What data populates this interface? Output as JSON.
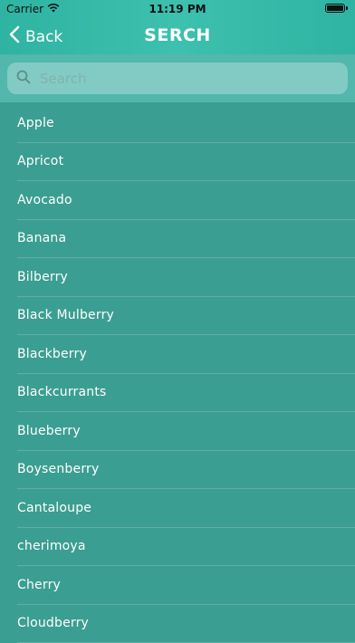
{
  "status_bar": {
    "carrier": "Carrier",
    "time": "11:19 PM"
  },
  "nav": {
    "back_label": "Back",
    "title": "SERCH"
  },
  "search": {
    "placeholder": "Search"
  },
  "fruits": [
    "Apple",
    "Apricot",
    "Avocado",
    "Banana",
    "Bilberry",
    "Black Mulberry",
    "Blackberry",
    "Blackcurrants",
    "Blueberry",
    "Boysenberry",
    "Cantaloupe",
    "cherimoya",
    "Cherry",
    "Cloudberry"
  ],
  "colors": {
    "header": "#39b8a6",
    "search_bar_bg": "#52b7ad",
    "list_bg": "#3b9e92",
    "text": "#ffffff"
  }
}
